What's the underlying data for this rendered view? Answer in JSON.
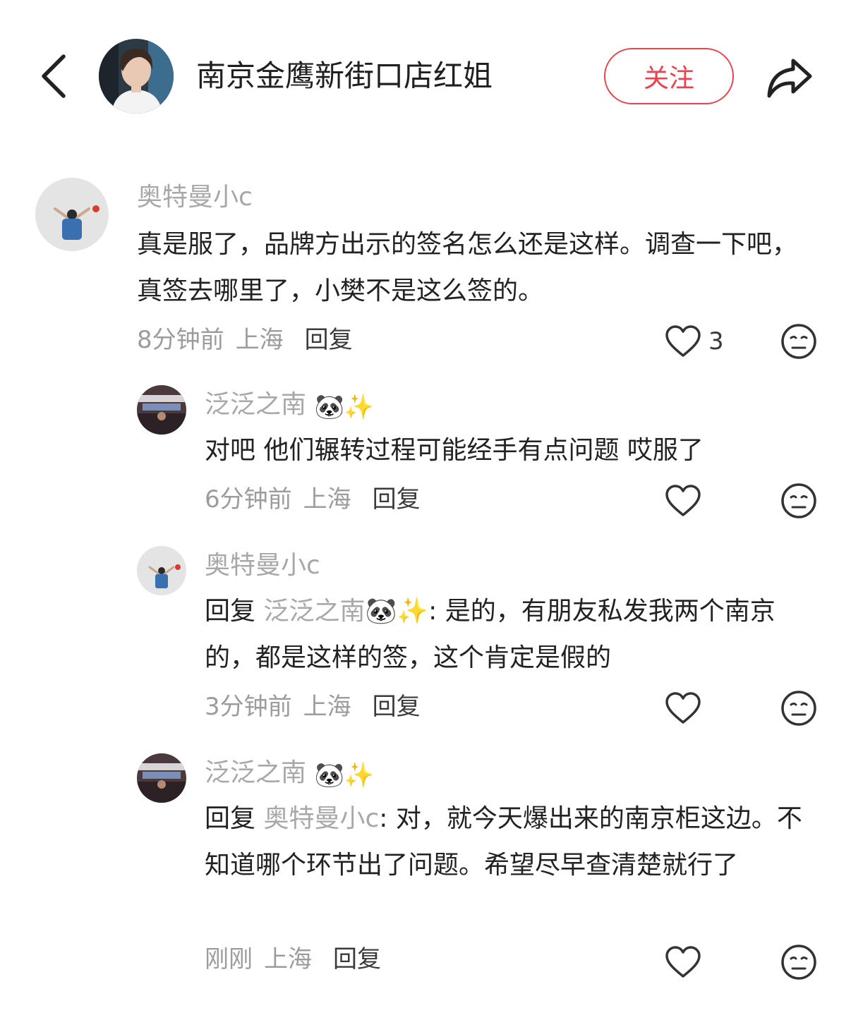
{
  "header": {
    "back_icon": "chevron-left-icon",
    "title": "南京金鹰新街口店红姐",
    "follow_label": "关注",
    "share_icon": "share-arrow-icon",
    "accent_color": "#e9434f"
  },
  "comments": [
    {
      "author": "奥特曼小c",
      "text": "真是服了，品牌方出示的签名怎么还是这样。调查一下吧，真签去哪里了，小樊不是这么签的。",
      "time": "8分钟前",
      "location": "上海",
      "reply_label": "回复",
      "likes": "3"
    },
    {
      "author": "泛泛之南",
      "author_emoji": "🐼✨",
      "text": "对吧 他们辗转过程可能经手有点问题 哎服了",
      "time": "6分钟前",
      "location": "上海",
      "reply_label": "回复"
    },
    {
      "author": "奥特曼小c",
      "reply_prefix": "回复",
      "mention": "泛泛之南",
      "mention_emoji": "🐼✨",
      "text": ": 是的，有朋友私发我两个南京的，都是这样的签，这个肯定是假的",
      "time": "3分钟前",
      "location": "上海",
      "reply_label": "回复"
    },
    {
      "author": "泛泛之南",
      "author_emoji": "🐼✨",
      "reply_prefix": "回复",
      "mention": "奥特曼小c",
      "text": ": 对，就今天爆出来的南京柜这边。不知道哪个环节出了问题。希望尽早查清楚就行了",
      "time": "刚刚",
      "location": "上海",
      "reply_label": "回复"
    }
  ]
}
